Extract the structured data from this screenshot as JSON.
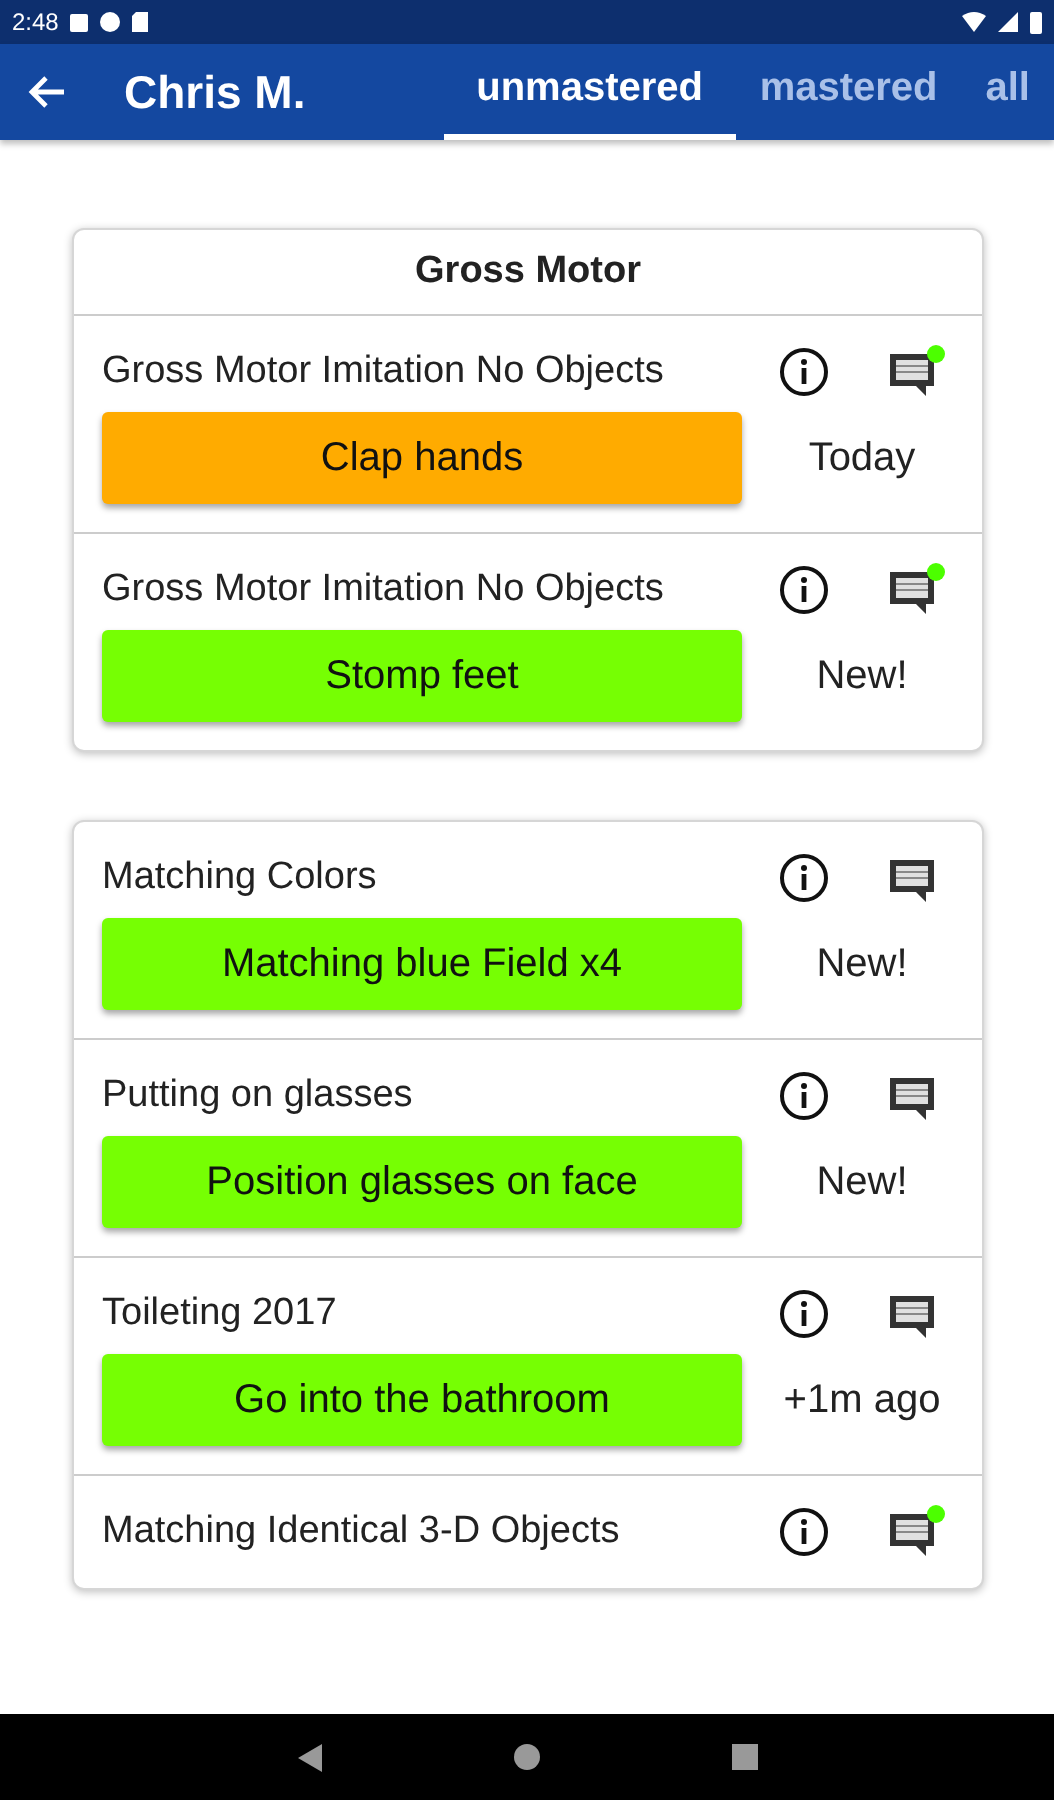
{
  "status_bar": {
    "time": "2:48"
  },
  "app_bar": {
    "title": "Chris M."
  },
  "tabs": [
    {
      "label": "unmastered",
      "selected": true
    },
    {
      "label": "mastered",
      "selected": false
    },
    {
      "label": "all",
      "selected": false
    }
  ],
  "cards": [
    {
      "header": "Gross Motor",
      "items": [
        {
          "title": "Gross Motor Imitation No Objects",
          "target": "Clap hands",
          "color": "#ffab00",
          "status": "Today",
          "new_comment": true
        },
        {
          "title": "Gross Motor Imitation No Objects",
          "target": "Stomp feet",
          "color": "#76ff03",
          "status": "New!",
          "new_comment": true
        }
      ]
    },
    {
      "items": [
        {
          "title": "Matching Colors",
          "target": "Matching blue Field x4",
          "color": "#76ff03",
          "status": "New!",
          "new_comment": false
        },
        {
          "title": "Putting on glasses",
          "target": "Position glasses on face",
          "color": "#76ff03",
          "status": "New!",
          "new_comment": false
        },
        {
          "title": "Toileting 2017",
          "target": "Go into the bathroom",
          "color": "#76ff03",
          "status": "+1m ago",
          "new_comment": false
        },
        {
          "title": "Matching Identical 3-D Objects",
          "new_comment": true
        }
      ]
    }
  ]
}
